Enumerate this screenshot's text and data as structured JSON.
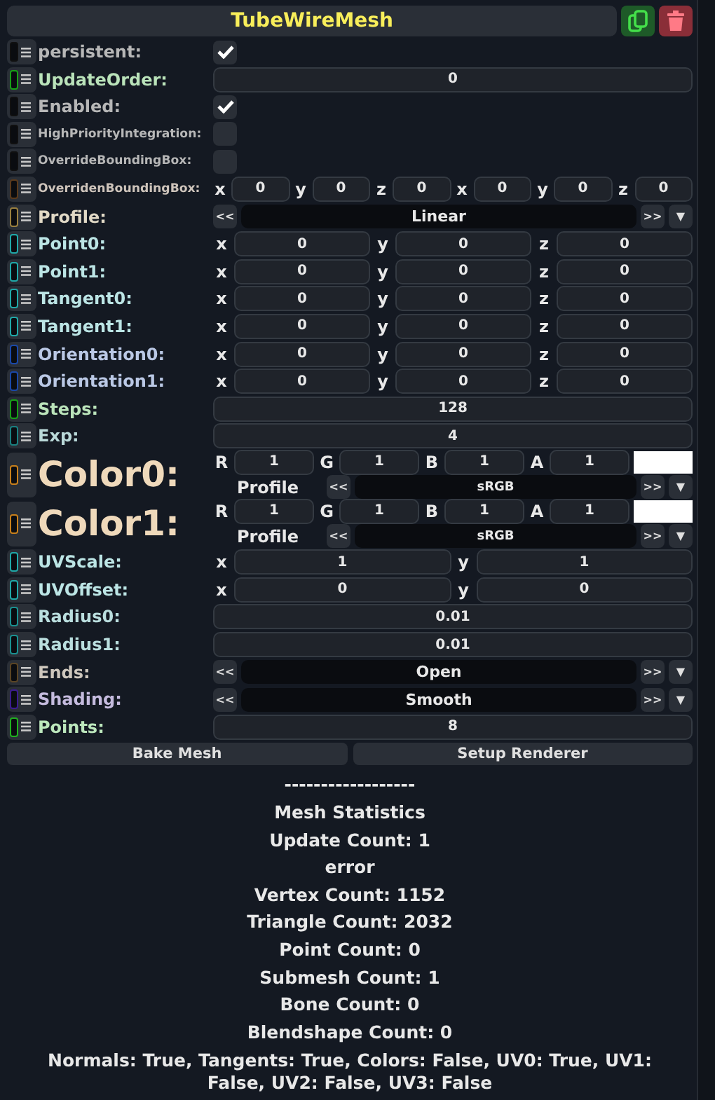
{
  "header": {
    "title": "TubeWireMesh"
  },
  "fields": [
    {
      "kind": "bool",
      "label": "persistent:",
      "color": "#101010",
      "checked": true
    },
    {
      "kind": "number",
      "label": "UpdateOrder:",
      "color": "#18a018",
      "value": "0"
    },
    {
      "kind": "bool",
      "label": "Enabled:",
      "color": "#101010",
      "checked": true
    },
    {
      "kind": "bool",
      "label": "HighPriorityIntegration:",
      "color": "#101010",
      "checked": false
    },
    {
      "kind": "bool",
      "label": "OverrideBoundingBox:",
      "color": "#101010",
      "checked": false
    },
    {
      "kind": "vector",
      "label": "OverridenBoundingBox:",
      "color": "#5a3a1c",
      "components": [
        {
          "axis": "x",
          "value": "0"
        },
        {
          "axis": "y",
          "value": "0"
        },
        {
          "axis": "z",
          "value": "0"
        },
        {
          "axis": "x",
          "value": "0"
        },
        {
          "axis": "y",
          "value": "0"
        },
        {
          "axis": "z",
          "value": "0"
        }
      ]
    },
    {
      "kind": "enum",
      "label": "Profile:",
      "color": "#9a8040",
      "value": "Linear",
      "prev": "<<",
      "next": ">>",
      "menu": "▼"
    },
    {
      "kind": "vector",
      "label": "Point0:",
      "color": "#20a8a8",
      "components": [
        {
          "axis": "x",
          "value": "0"
        },
        {
          "axis": "y",
          "value": "0"
        },
        {
          "axis": "z",
          "value": "0"
        }
      ]
    },
    {
      "kind": "vector",
      "label": "Point1:",
      "color": "#20a8a8",
      "components": [
        {
          "axis": "x",
          "value": "0"
        },
        {
          "axis": "y",
          "value": "0"
        },
        {
          "axis": "z",
          "value": "0"
        }
      ]
    },
    {
      "kind": "vector",
      "label": "Tangent0:",
      "color": "#20a8a8",
      "components": [
        {
          "axis": "x",
          "value": "0"
        },
        {
          "axis": "y",
          "value": "0"
        },
        {
          "axis": "z",
          "value": "0"
        }
      ]
    },
    {
      "kind": "vector",
      "label": "Tangent1:",
      "color": "#20a8a8",
      "components": [
        {
          "axis": "x",
          "value": "0"
        },
        {
          "axis": "y",
          "value": "0"
        },
        {
          "axis": "z",
          "value": "0"
        }
      ]
    },
    {
      "kind": "vector",
      "label": "Orientation0:",
      "color": "#1a48a8",
      "components": [
        {
          "axis": "x",
          "value": "0"
        },
        {
          "axis": "y",
          "value": "0"
        },
        {
          "axis": "z",
          "value": "0"
        }
      ]
    },
    {
      "kind": "vector",
      "label": "Orientation1:",
      "color": "#1a48a8",
      "components": [
        {
          "axis": "x",
          "value": "0"
        },
        {
          "axis": "y",
          "value": "0"
        },
        {
          "axis": "z",
          "value": "0"
        }
      ]
    },
    {
      "kind": "number",
      "label": "Steps:",
      "color": "#18a018",
      "value": "128"
    },
    {
      "kind": "number",
      "label": "Exp:",
      "color": "#1a8080",
      "value": "4"
    },
    {
      "kind": "color",
      "label": "Color0:",
      "color": "#c8801c",
      "components": [
        {
          "axis": "R",
          "value": "1"
        },
        {
          "axis": "G",
          "value": "1"
        },
        {
          "axis": "B",
          "value": "1"
        },
        {
          "axis": "A",
          "value": "1"
        }
      ],
      "swatch": {
        "color": "#ffffff"
      },
      "profile_label": "Profile",
      "value": "sRGB",
      "prev": "<<",
      "next": ">>",
      "menu": "▼"
    },
    {
      "kind": "color",
      "label": "Color1:",
      "color": "#c8801c",
      "components": [
        {
          "axis": "R",
          "value": "1"
        },
        {
          "axis": "G",
          "value": "1"
        },
        {
          "axis": "B",
          "value": "1"
        },
        {
          "axis": "A",
          "value": "1"
        }
      ],
      "swatch": {
        "color": "#ffffff"
      },
      "profile_label": "Profile",
      "value": "sRGB",
      "prev": "<<",
      "next": ">>",
      "menu": "▼"
    },
    {
      "kind": "vector",
      "label": "UVScale:",
      "color": "#20a8a8",
      "components": [
        {
          "axis": "x",
          "value": "1"
        },
        {
          "axis": "y",
          "value": "1"
        }
      ]
    },
    {
      "kind": "vector",
      "label": "UVOffset:",
      "color": "#20a8a8",
      "components": [
        {
          "axis": "x",
          "value": "0"
        },
        {
          "axis": "y",
          "value": "0"
        }
      ]
    },
    {
      "kind": "number",
      "label": "Radius0:",
      "color": "#1a9090",
      "value": "0.01"
    },
    {
      "kind": "number",
      "label": "Radius1:",
      "color": "#1a9090",
      "value": "0.01"
    },
    {
      "kind": "enum",
      "label": "Ends:",
      "color": "#5a4424",
      "value": "Open",
      "prev": "<<",
      "next": ">>",
      "menu": "▼"
    },
    {
      "kind": "enum",
      "label": "Shading:",
      "color": "#3c1c90",
      "value": "Smooth",
      "prev": "<<",
      "next": ">>",
      "menu": "▼"
    },
    {
      "kind": "number",
      "label": "Points:",
      "color": "#20b020",
      "value": "8"
    }
  ],
  "buttons": [
    "Bake Mesh",
    "Setup Renderer"
  ],
  "stats": [
    "------------------",
    "Mesh Statistics",
    "Update Count: 1",
    "error",
    "Vertex Count: 1152",
    "Triangle Count: 2032",
    "Point Count: 0",
    "Submesh Count: 1",
    "Bone Count: 0",
    "Blendshape Count: 0",
    "Normals: True, Tangents: True, Colors: False, UV0: True, UV1: False, UV2: False, UV3: False"
  ]
}
